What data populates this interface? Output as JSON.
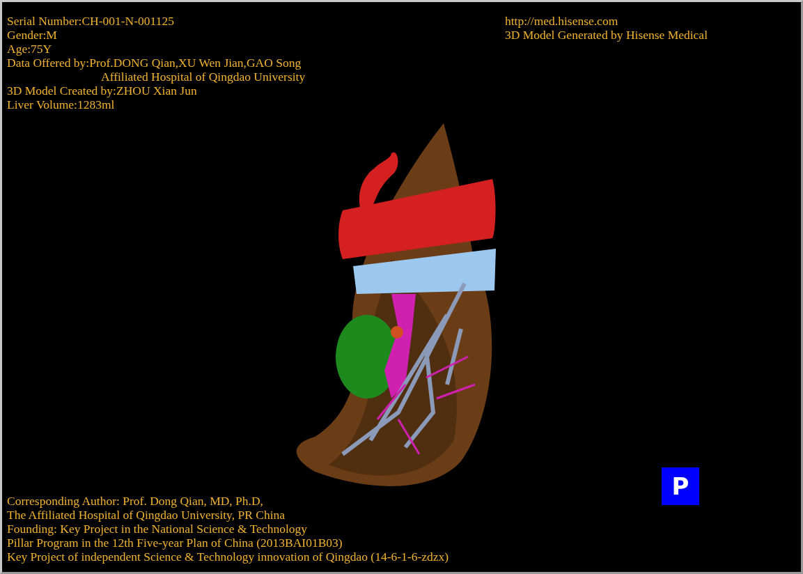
{
  "header_left": [
    {
      "text": "Serial Number:CH-001-N-001125",
      "indented": false
    },
    {
      "text": "Gender:M",
      "indented": false
    },
    {
      "text": "Age:75Y",
      "indented": false
    },
    {
      "text": "Data Offered by:Prof.DONG Qian,XU Wen Jian,GAO Song",
      "indented": false
    },
    {
      "text": "Affiliated Hospital of Qingdao University",
      "indented": true
    },
    {
      "text": "3D Model Created by:ZHOU Xian Jun",
      "indented": false
    },
    {
      "text": "Liver Volume:1283ml",
      "indented": false
    }
  ],
  "header_right": [
    "http://med.hisense.com",
    "3D Model Generated by Hisense Medical"
  ],
  "footer": [
    "Corresponding Author: Prof. Dong Qian, MD, Ph.D,",
    "The Affiliated Hospital of Qingdao University, PR China",
    "Founding: Key Project in the National Science & Technology",
    "Pillar Program in the 12th Five-year Plan of China (2013BAI01B03)",
    "Key Project of independent Science & Technology innovation of Qingdao (14-6-1-6-zdzx)"
  ],
  "orientation_marker": {
    "label": "P"
  }
}
